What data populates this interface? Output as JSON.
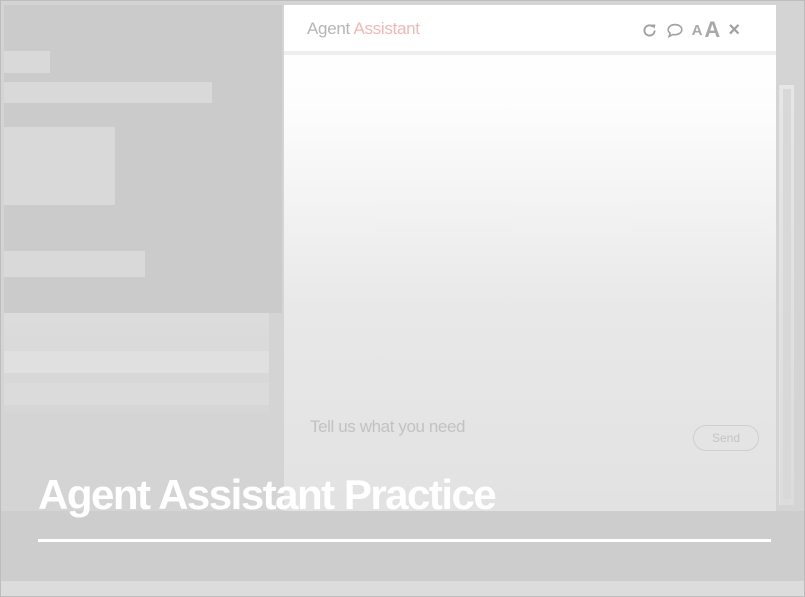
{
  "chat": {
    "title_part1": "Agent",
    "title_part2": "Assistant",
    "input_placeholder": "Tell us what you need",
    "send_label": "Send",
    "icons": {
      "refresh": "refresh-icon",
      "chat": "speech-bubble-icon",
      "font_small": "A",
      "font_large": "A",
      "close": "×"
    }
  },
  "overlay": {
    "title": "Agent Assistant Practice"
  },
  "colors": {
    "accent": "#f2b8b8",
    "title_text": "#ffffff"
  }
}
